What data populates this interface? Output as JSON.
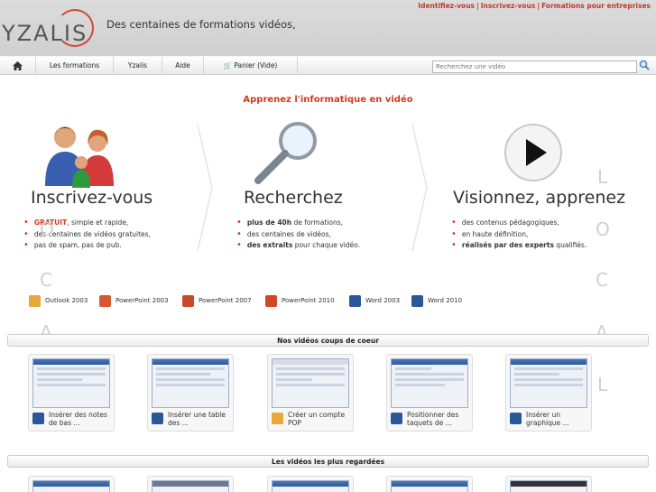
{
  "header": {
    "logo_text": "YZALIS",
    "tagline": "Des centaines de formations vidéos,",
    "top_links": [
      "Identifiez-vous",
      "Inscrivez-vous",
      "Formations pour entreprises"
    ],
    "link_separator": "|"
  },
  "nav": {
    "home_icon": "home-icon",
    "items": [
      "Les formations",
      "Yzalis",
      "Aide"
    ],
    "cart_label": "Panier",
    "cart_status": "(Vide)",
    "search_placeholder": "Recherchez une vidéo"
  },
  "main": {
    "title": "Apprenez l'informatique en vidéo",
    "columns": [
      {
        "title": "Inscrivez-vous",
        "icon": "users-icon",
        "bullets": [
          {
            "strong": "GRATUIT",
            "rest": ", simple et rapide,"
          },
          {
            "strong": "",
            "rest": "des centaines de vidéos gratuites,"
          },
          {
            "strong": "",
            "rest": "pas de spam, pas de pub."
          }
        ]
      },
      {
        "title": "Recherchez",
        "icon": "magnifier-icon",
        "bullets": [
          {
            "strong": "plus de 40h",
            "rest": " de formations,"
          },
          {
            "strong": "",
            "rest": "des centaines de vidéos,"
          },
          {
            "strong": "des extraits",
            "rest": " pour chaque vidéo."
          }
        ]
      },
      {
        "title": "Visionnez, apprenez",
        "icon": "play-icon",
        "bullets": [
          {
            "strong": "",
            "rest": "des contenus pédagogiques,"
          },
          {
            "strong": "",
            "rest": "en haute définition,"
          },
          {
            "strong": "réalisés par des experts",
            "rest": " qualifiés."
          }
        ]
      }
    ],
    "products": [
      {
        "label": "Outlook 2003",
        "color": "#e8a93a"
      },
      {
        "label": "PowerPoint 2003",
        "color": "#d9572e"
      },
      {
        "label": "PowerPoint 2007",
        "color": "#c84a2a"
      },
      {
        "label": "PowerPoint 2010",
        "color": "#d24726"
      },
      {
        "label": "Word 2003",
        "color": "#2b579a"
      },
      {
        "label": "Word 2010",
        "color": "#2b579a"
      }
    ],
    "side_letters_right": [
      "L",
      "O",
      "C",
      "A",
      "L"
    ],
    "side_letters_left": [
      "L",
      "O",
      "C",
      "A"
    ]
  },
  "favorites": {
    "title": "Nos vidéos coups de coeur",
    "cards": [
      {
        "title": "Insérer des notes de bas ...",
        "app": "word",
        "color": "#2b579a"
      },
      {
        "title": "Insérer une table des ...",
        "app": "word",
        "color": "#2b579a"
      },
      {
        "title": "Créer un compte POP",
        "app": "outlook",
        "color": "#e8a93a"
      },
      {
        "title": "Positionner des taquets de ...",
        "app": "word",
        "color": "#2b579a"
      },
      {
        "title": "Insérer un graphique ...",
        "app": "word",
        "color": "#2b579a"
      }
    ]
  },
  "most_viewed": {
    "title": "Les vidéos les plus regardées"
  },
  "colors": {
    "accent": "#d43a20",
    "header_bg": "#d4d4d4"
  }
}
